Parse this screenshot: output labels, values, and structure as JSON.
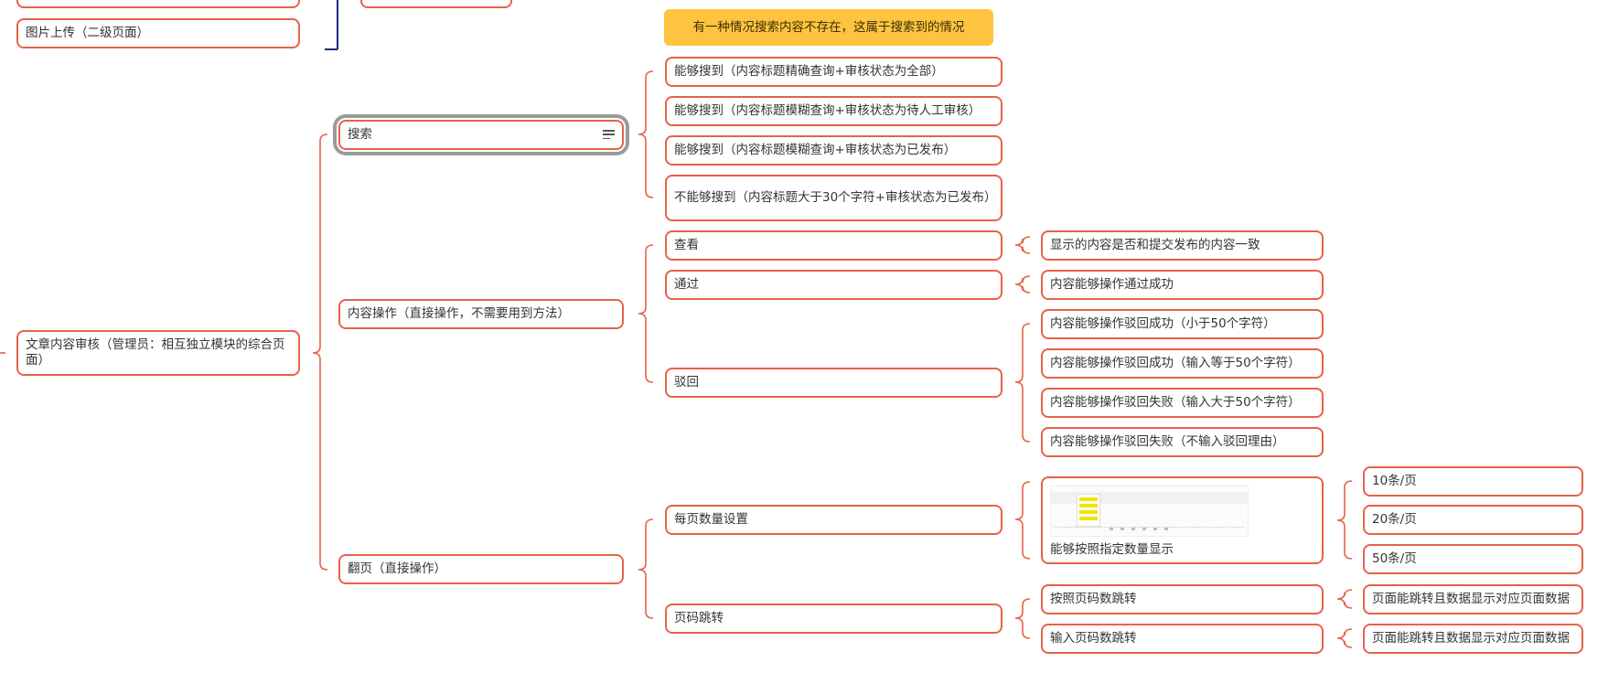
{
  "colors": {
    "accent": "#e8614a",
    "callout_fill": "#fec43f",
    "left_bracket": "#1f2a7a",
    "selection_ring": "#9a9a9a"
  },
  "level1": {
    "truncated_top": "",
    "image_upload": "图片上传（二级页面）",
    "content_review": "文章内容审核（管理员：相互独立模块的综合页面）"
  },
  "level2": {
    "truncated_top": "",
    "search": "搜索",
    "content_ops": "内容操作（直接操作，不需要用到方法）",
    "paging": "翻页（直接操作）"
  },
  "callout": {
    "search_note": "有一种情况搜索内容不存在，这属于搜索到的情况"
  },
  "search_cases": [
    "能够搜到（内容标题精确查询+审核状态为全部）",
    "能够搜到（内容标题模糊查询+审核状态为待人工审核）",
    "能够搜到（内容标题模糊查询+审核状态为已发布）",
    "不能够搜到（内容标题大于30个字符+审核状态为已发布）"
  ],
  "ops": {
    "view": "查看",
    "approve": "通过",
    "reject": "驳回"
  },
  "op_results": {
    "view": "显示的内容是否和提交发布的内容一致",
    "approve": "内容能够操作通过成功",
    "reject": [
      "内容能够操作驳回成功（小于50个字符）",
      "内容能够操作驳回成功（输入等于50个字符）",
      "内容能够操作驳回失败（输入大于50个字符）",
      "内容能够操作驳回失败（不输入驳回理由）"
    ]
  },
  "paging_items": {
    "per_page": "每页数量设置",
    "jump": "页码跳转"
  },
  "per_page_result": "能够按照指定数量显示",
  "per_page_options": [
    "10条/页",
    "20条/页",
    "50条/页"
  ],
  "jump_methods": [
    "按照页码数跳转",
    "输入页码数跳转"
  ],
  "jump_results": [
    "页面能跳转且数据显示对应页面数据",
    "页面能跳转且数据显示对应页面数据"
  ]
}
